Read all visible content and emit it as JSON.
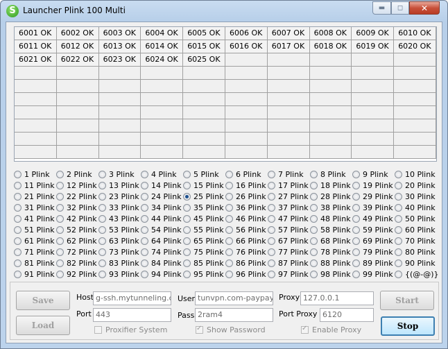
{
  "window": {
    "title": "Launcher Plink 100 Multi",
    "icon_letter": "S"
  },
  "grid": {
    "columns": 10,
    "rows": 10,
    "entries": [
      "6001 OK",
      "6002 OK",
      "6003 OK",
      "6004 OK",
      "6005 OK",
      "6006 OK",
      "6007 OK",
      "6008 OK",
      "6009 OK",
      "6010 OK",
      "6011 OK",
      "6012 OK",
      "6013 OK",
      "6014 OK",
      "6015 OK",
      "6016 OK",
      "6017 OK",
      "6018 OK",
      "6019 OK",
      "6020 OK",
      "6021 OK",
      "6022 OK",
      "6023 OK",
      "6024 OK",
      "6025 OK"
    ]
  },
  "radios": {
    "selected_index": 24,
    "labels": [
      "1 Plink",
      "2 Plink",
      "3 Plink",
      "4 Plink",
      "5 Plink",
      "6 Plink",
      "7 Plink",
      "8 Plink",
      "9 Plink",
      "10 Plink",
      "11 Plink",
      "12 Plink",
      "13 Plink",
      "14 Plink",
      "15 Plink",
      "16 Plink",
      "17 Plink",
      "18 Plink",
      "19 Plink",
      "20 Plink",
      "21 Plink",
      "22 Plink",
      "23 Plink",
      "24 Plink",
      "25 Plink",
      "26 Plink",
      "27 Plink",
      "28 Plink",
      "29 Plink",
      "30 Plink",
      "31 Plink",
      "32 Plink",
      "33 Plink",
      "34 Plink",
      "35 Plink",
      "36 Plink",
      "37 Plink",
      "38 Plink",
      "39 Plink",
      "40 Plink",
      "41 Plink",
      "42 Plink",
      "43 Plink",
      "44 Plink",
      "45 Plink",
      "46 Plink",
      "47 Plink",
      "48 Plink",
      "49 Plink",
      "50 Plink",
      "51 Plink",
      "52 Plink",
      "53 Plink",
      "54 Plink",
      "55 Plink",
      "56 Plink",
      "57 Plink",
      "58 Plink",
      "59 Plink",
      "60 Plink",
      "61 Plink",
      "62 Plink",
      "63 Plink",
      "64 Plink",
      "65 Plink",
      "66 Plink",
      "67 Plink",
      "68 Plink",
      "69 Plink",
      "70 Plink",
      "71 Plink",
      "72 Plink",
      "73 Plink",
      "74 Plink",
      "75 Plink",
      "76 Plink",
      "77 Plink",
      "78 Plink",
      "79 Plink",
      "80 Plink",
      "81 Plink",
      "82 Plink",
      "83 Plink",
      "84 Plink",
      "85 Plink",
      "86 Plink",
      "87 Plink",
      "88 Plink",
      "89 Plink",
      "90 Plink",
      "91 Plink",
      "92 Plink",
      "93 Plink",
      "94 Plink",
      "95 Plink",
      "96 Plink",
      "97 Plink",
      "98 Plink",
      "99 Plink",
      "{(@-@)}"
    ]
  },
  "settings": {
    "save_label": "Save",
    "load_label": "Load",
    "start_label": "Start",
    "stop_label": "Stop",
    "host_label": "Host",
    "host_value": "g-ssh.mytunneling.com",
    "port_label": "Port",
    "port_value": "443",
    "user_label": "User",
    "user_value": "tunvpn.com-paypay",
    "pass_label": "Pass",
    "pass_value": "2ram4",
    "proxy_label": "Proxy",
    "proxy_value": "127.0.0.1",
    "proxy_port_label": "Port Proxy",
    "proxy_port_value": "6120",
    "proxifier_label": "Proxifier System",
    "proxifier_checked": false,
    "show_password_label": "Show Password",
    "show_password_checked": true,
    "enable_proxy_label": "Enable Proxy",
    "enable_proxy_checked": true
  }
}
